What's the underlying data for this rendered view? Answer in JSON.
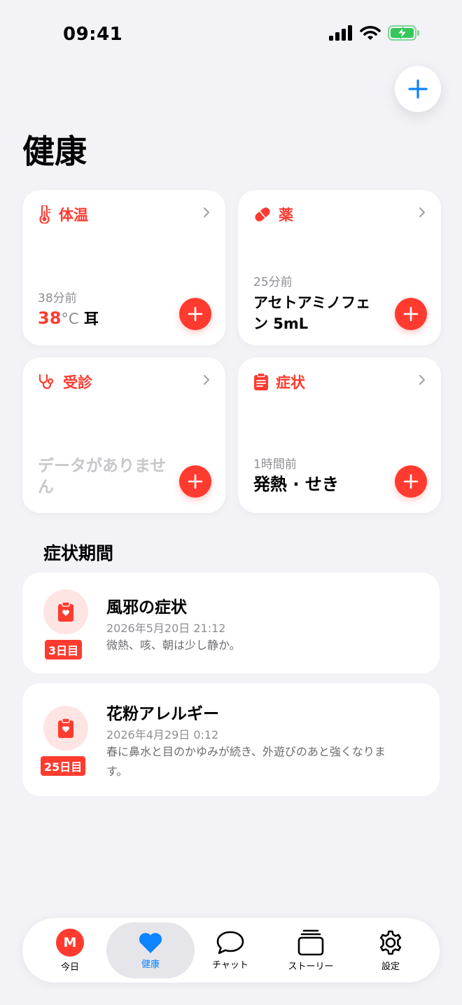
{
  "status": {
    "time": "09:41"
  },
  "page": {
    "title": "健康"
  },
  "cards": {
    "temperature": {
      "title": "体温",
      "sub": "38分前",
      "value": "38",
      "unit": "°C",
      "site": "耳"
    },
    "medicine": {
      "title": "薬",
      "sub": "25分前",
      "value": "アセトアミノフェン 5mL"
    },
    "visit": {
      "title": "受診",
      "empty": "データがありません"
    },
    "symptoms": {
      "title": "症状",
      "sub": "1時間前",
      "value": "発熱 · せき"
    }
  },
  "periods": {
    "title": "症状期間",
    "items": [
      {
        "title": "風邪の症状",
        "date": "2026年5月20日 21:12",
        "note": "微熱、咳、朝は少し静か。",
        "badge": "3日目"
      },
      {
        "title": "花粉アレルギー",
        "date": "2026年4月29日 0:12",
        "note": "春に鼻水と目のかゆみが続き、外遊びのあと強くなります。",
        "badge": "25日目"
      }
    ]
  },
  "tabs": [
    {
      "label": "今日",
      "avatar": "M"
    },
    {
      "label": "健康"
    },
    {
      "label": "チャット"
    },
    {
      "label": "ストーリー"
    },
    {
      "label": "設定"
    }
  ],
  "colors": {
    "accent_red": "#ff3b30",
    "accent_blue": "#0a84ff",
    "battery_green": "#34c759"
  },
  "icons": {
    "add": "plus-icon",
    "temperature": "thermometer-icon",
    "medicine": "pill-icon",
    "visit": "stethoscope-icon",
    "symptoms": "clipboard-icon",
    "health": "heart-icon",
    "chat": "chat-bubble-icon",
    "story": "stack-icon",
    "settings": "gear-icon"
  }
}
